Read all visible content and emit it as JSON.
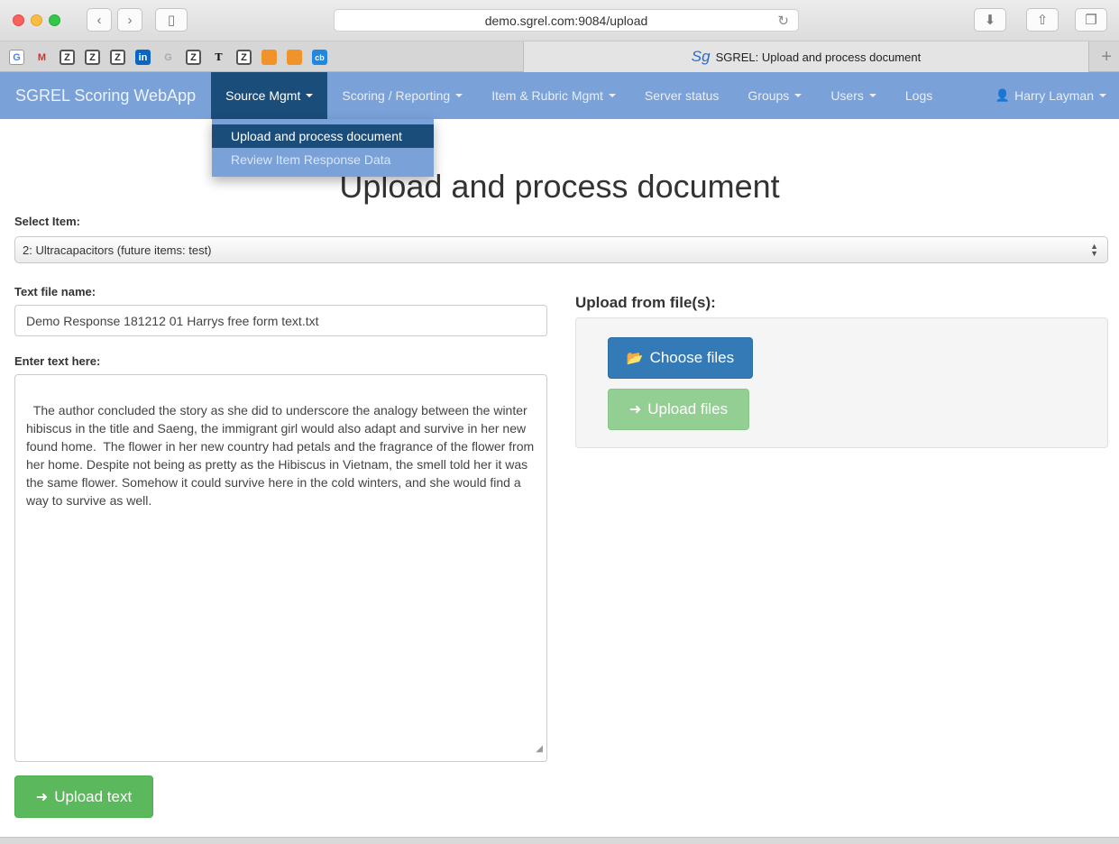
{
  "browser": {
    "url": "demo.sgrel.com:9084/upload",
    "tab_title": "SGREL: Upload and process document",
    "tab_favicon": "Sg",
    "bookmarks": [
      "G",
      "M",
      "Z",
      "Z",
      "Z",
      "in",
      "G",
      "Z",
      "T",
      "Z",
      "box",
      "box",
      "cb"
    ]
  },
  "navbar": {
    "brand": "SGREL Scoring WebApp",
    "items": [
      {
        "label": "Source Mgmt",
        "dropdown": true,
        "active": true
      },
      {
        "label": "Scoring / Reporting",
        "dropdown": true
      },
      {
        "label": "Item & Rubric Mgmt",
        "dropdown": true
      },
      {
        "label": "Server status",
        "dropdown": false
      },
      {
        "label": "Groups",
        "dropdown": true
      },
      {
        "label": "Users",
        "dropdown": true
      },
      {
        "label": "Logs",
        "dropdown": false
      }
    ],
    "user": "Harry Layman"
  },
  "dropdown": {
    "items": [
      {
        "label": "Upload and process document",
        "active": true
      },
      {
        "label": "Review Item Response Data",
        "active": false
      }
    ]
  },
  "page": {
    "title": "Upload and process document",
    "select_item_label": "Select Item:",
    "select_item_value": "2: Ultracapacitors (future items: test)",
    "text_file_name_label": "Text file name:",
    "text_file_name_value": "Demo Response 181212 01 Harrys free form text.txt",
    "enter_text_label": "Enter text here:",
    "text_content": "The author concluded the story as she did to underscore the analogy between the winter hibiscus in the title and Saeng, the immigrant girl would also adapt and survive in her new found home.  The flower in her new country had petals and the fragrance of the flower from her home. Despite not being as pretty as the Hibiscus in Vietnam, the smell told her it was the same flower. Somehow it could survive here in the cold winters, and she would find a way to survive as well.",
    "upload_text_button": "Upload text",
    "upload_from_files_heading": "Upload from file(s):",
    "choose_files_button": "Choose files",
    "upload_files_button": "Upload files"
  },
  "colors": {
    "navbar_bg": "#7aa1d8",
    "navbar_active": "#1b4d7b",
    "primary": "#337ab7",
    "success": "#5cb85c"
  }
}
